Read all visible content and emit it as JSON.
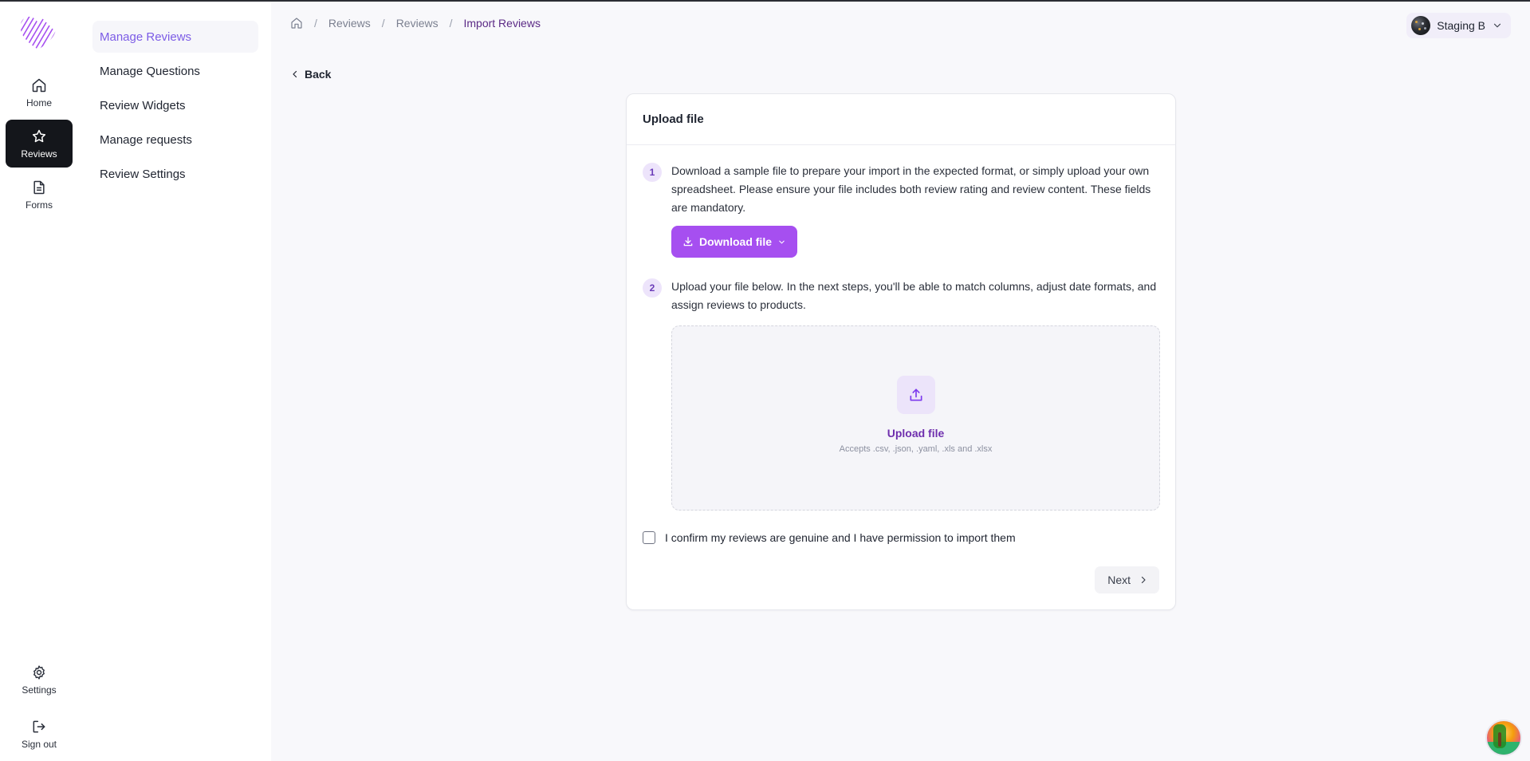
{
  "rail": {
    "items": [
      {
        "label": "Home",
        "icon": "home-icon"
      },
      {
        "label": "Reviews",
        "icon": "star-icon",
        "active": true
      },
      {
        "label": "Forms",
        "icon": "document-icon"
      }
    ],
    "bottom": [
      {
        "label": "Settings",
        "icon": "gear-icon"
      },
      {
        "label": "Sign out",
        "icon": "sign-out-icon"
      }
    ]
  },
  "subnav": {
    "items": [
      {
        "label": "Manage Reviews",
        "active": true
      },
      {
        "label": "Manage Questions"
      },
      {
        "label": "Review Widgets"
      },
      {
        "label": "Manage requests"
      },
      {
        "label": "Review Settings"
      }
    ]
  },
  "breadcrumb": {
    "items": [
      "Reviews",
      "Reviews"
    ],
    "current": "Import Reviews",
    "separator": "/"
  },
  "store": {
    "name": "Staging B"
  },
  "back_label": "Back",
  "card": {
    "title": "Upload file",
    "step1": {
      "number": "1",
      "text": "Download a sample file to prepare your import in the expected format, or simply upload your own spreadsheet. Please ensure your file includes both review rating and review content. These fields are mandatory."
    },
    "download_label": "Download file",
    "step2": {
      "number": "2",
      "text": "Upload your file below. In the next steps, you'll be able to match columns, adjust date formats, and assign reviews to products."
    },
    "dropzone": {
      "title": "Upload file",
      "subtitle": "Accepts .csv, .json, .yaml, .xls and .xlsx"
    },
    "confirm_label": "I confirm my reviews are genuine and I have permission to import them",
    "next_label": "Next"
  },
  "colors": {
    "accent": "#a64ff0",
    "accent_text": "#6f2fae",
    "active_nav_text": "#7c5ce6",
    "rail_active_bg": "#14161b"
  }
}
